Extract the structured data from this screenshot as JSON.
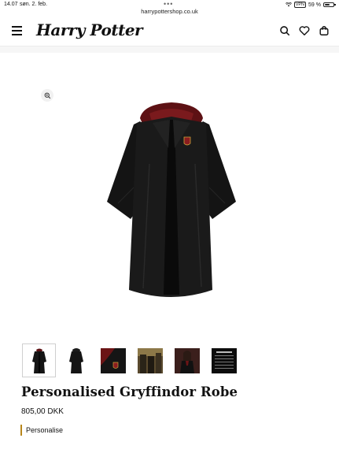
{
  "status_bar": {
    "time": "14.07",
    "date": "søn. 2. feb.",
    "url": "harrypottershop.co.uk",
    "vpn": "VPN",
    "battery": "59 %",
    "battery_level": 0.59
  },
  "header": {
    "logo": "Harry Potter"
  },
  "icons": {
    "menu": "hamburger-menu-icon",
    "search": "search-icon",
    "wishlist": "heart-icon",
    "bag": "shopping-bag-icon",
    "zoom": "zoom-in-icon"
  },
  "product": {
    "title": "Personalised Gryffindor Robe",
    "price": "805,00 DKK",
    "personalise_label": "Personalise"
  },
  "thumbnails": [
    {
      "name": "robe-front",
      "selected": true
    },
    {
      "name": "robe-back",
      "selected": false
    },
    {
      "name": "hood-crest",
      "selected": false
    },
    {
      "name": "lifestyle-1",
      "selected": false
    },
    {
      "name": "lifestyle-2",
      "selected": false
    },
    {
      "name": "size-chart",
      "selected": false
    }
  ],
  "colors": {
    "robe": "#111111",
    "hood_lining": "#6b1416",
    "accent": "#b8861b"
  }
}
